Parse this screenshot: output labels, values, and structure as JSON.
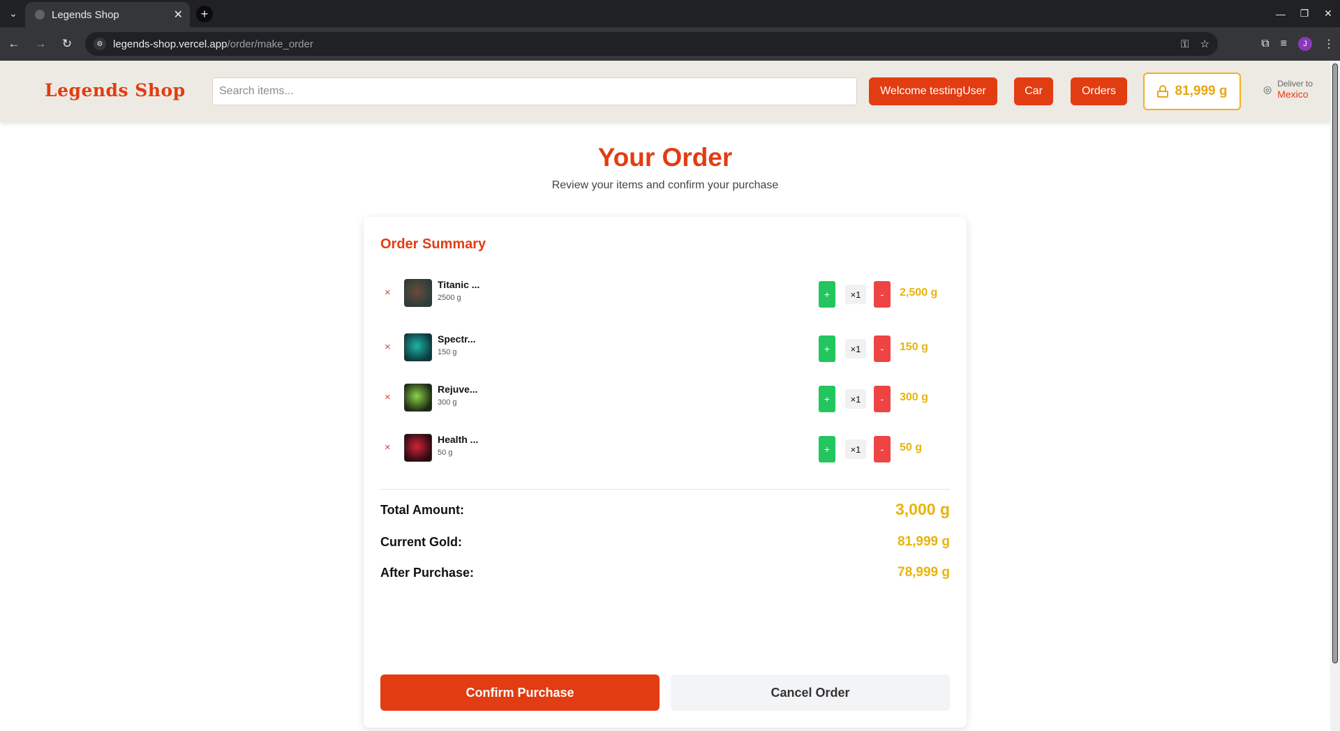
{
  "browser": {
    "tab_title": "Legends Shop",
    "url_host": "legends-shop.vercel.app",
    "url_path": "/order/make_order",
    "profile_initial": "J"
  },
  "header": {
    "logo": "Legends Shop",
    "search_placeholder": "Search items...",
    "welcome_label": "Welcome testingUser",
    "car_label": "Car",
    "orders_label": "Orders",
    "gold_balance": "81,999 g",
    "deliver_label": "Deliver to",
    "deliver_value": "Mexico"
  },
  "page": {
    "title": "Your Order",
    "subtitle": "Review your items and confirm your purchase"
  },
  "order": {
    "summary_title": "Order Summary",
    "remove_symbol": "×",
    "plus_symbol": "+",
    "minus_symbol": "-",
    "items": [
      {
        "name": "Titanic ...",
        "price": "2500 g",
        "qty": "×1",
        "total": "2,500 g",
        "thumb_colors": [
          "#6b4a3a",
          "#2c3e3a"
        ]
      },
      {
        "name": "Spectr...",
        "price": "150 g",
        "qty": "×1",
        "total": "150 g",
        "thumb_colors": [
          "#1fb3a6",
          "#0b3a40"
        ]
      },
      {
        "name": "Rejuve...",
        "price": "300 g",
        "qty": "×1",
        "total": "300 g",
        "thumb_colors": [
          "#8bd34a",
          "#1c2a10"
        ]
      },
      {
        "name": "Health ...",
        "price": "50 g",
        "qty": "×1",
        "total": "50 g",
        "thumb_colors": [
          "#d1233a",
          "#2a0a10"
        ]
      }
    ],
    "total_label": "Total Amount:",
    "total_value": "3,000 g",
    "current_label": "Current Gold:",
    "current_value": "81,999 g",
    "after_label": "After Purchase:",
    "after_value": "78,999 g",
    "confirm_label": "Confirm Purchase",
    "cancel_label": "Cancel Order"
  },
  "colors": {
    "brand": "#e23c12",
    "gold": "#eab308",
    "plus": "#22c55e",
    "minus": "#ef4444"
  }
}
